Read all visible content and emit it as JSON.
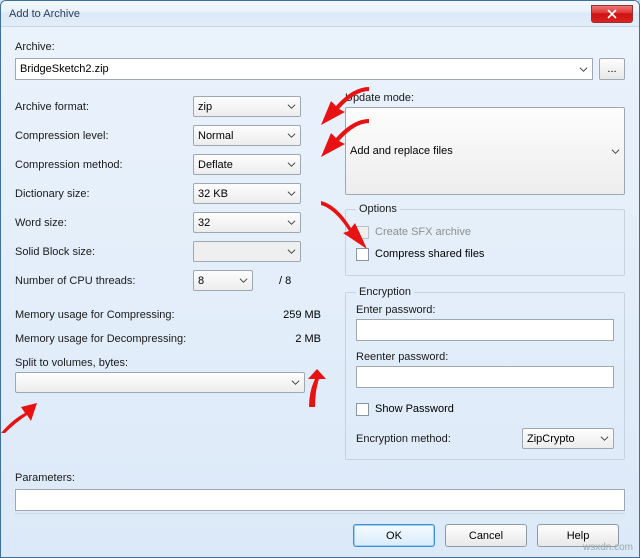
{
  "window": {
    "title": "Add to Archive"
  },
  "archive": {
    "label": "Archive:",
    "value": "BridgeSketch2.zip",
    "browse": "..."
  },
  "fields": {
    "archive_format": {
      "label": "Archive format:",
      "value": "zip"
    },
    "compression_level": {
      "label": "Compression level:",
      "value": "Normal"
    },
    "compression_method": {
      "label": "Compression method:",
      "value": "Deflate"
    },
    "dictionary_size": {
      "label": "Dictionary size:",
      "value": "32 KB"
    },
    "word_size": {
      "label": "Word size:",
      "value": "32"
    },
    "solid_block": {
      "label": "Solid Block size:",
      "value": ""
    },
    "cpu_threads": {
      "label": "Number of CPU threads:",
      "value": "8",
      "max": "/ 8"
    },
    "mem_compress": {
      "label": "Memory usage for Compressing:",
      "value": "259 MB"
    },
    "mem_decompress": {
      "label": "Memory usage for Decompressing:",
      "value": "2 MB"
    },
    "split": {
      "label": "Split to volumes, bytes:",
      "value": ""
    },
    "parameters": {
      "label": "Parameters:",
      "value": ""
    }
  },
  "update_mode": {
    "label": "Update mode:",
    "value": "Add and replace files"
  },
  "options": {
    "legend": "Options",
    "sfx": "Create SFX archive",
    "shared": "Compress shared files"
  },
  "encryption": {
    "legend": "Encryption",
    "enter": "Enter password:",
    "reenter": "Reenter password:",
    "show": "Show Password",
    "method_label": "Encryption method:",
    "method_value": "ZipCrypto"
  },
  "buttons": {
    "ok": "OK",
    "cancel": "Cancel",
    "help": "Help"
  },
  "watermark": "wsxdn.com"
}
